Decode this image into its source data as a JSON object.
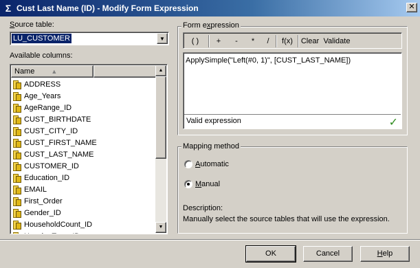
{
  "window": {
    "title": "Cust Last Name (ID) - Modify Form Expression",
    "close_glyph": "✕",
    "title_glyph": "Σ"
  },
  "source_table": {
    "label_prefix": "",
    "label_u": "S",
    "label_rest": "ource table:",
    "value": "LU_CUSTOMER"
  },
  "columns": {
    "label": "Available columns:",
    "headers": [
      "Name",
      ""
    ],
    "sort_glyph": "▲",
    "items": [
      "ADDRESS",
      "Age_Years",
      "AgeRange_ID",
      "CUST_BIRTHDATE",
      "CUST_CITY_ID",
      "CUST_FIRST_NAME",
      "CUST_LAST_NAME",
      "CUSTOMER_ID",
      "Education_ID",
      "EMAIL",
      "First_Order",
      "Gender_ID",
      "HouseholdCount_ID",
      "HousingType_ID"
    ]
  },
  "form_expression": {
    "title_pre": "Form e",
    "title_u": "x",
    "title_post": "pression",
    "toolbar": [
      "( )",
      "+",
      "-",
      "*",
      "/",
      "f(x)",
      "Clear",
      "Validate"
    ],
    "text": "ApplySimple(\"Left(#0, 1)\", [CUST_LAST_NAME])",
    "status": "Valid expression"
  },
  "mapping": {
    "title": "Mapping method",
    "automatic_u": "A",
    "automatic_rest": "utomatic",
    "manual_u": "M",
    "manual_rest": "anual",
    "selected": "Manual",
    "description_label": "Description:",
    "description": "Manually select the source tables that will use the expression."
  },
  "buttons": {
    "ok": "OK",
    "cancel": "Cancel",
    "help_u": "H",
    "help_rest": "elp"
  }
}
